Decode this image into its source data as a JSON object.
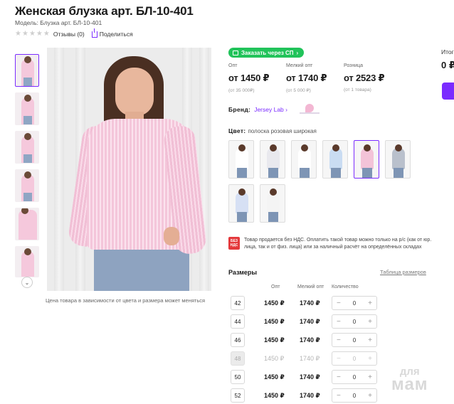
{
  "product": {
    "title": "Женская блузка арт. БЛ-10-401",
    "model": "Модель: Блузка арт. БЛ-10-401",
    "reviews": "Отзывы (0)",
    "share": "Поделиться",
    "rating": 0,
    "price_note": "Цена товара в зависимости от цвета и размера может меняться"
  },
  "sp_badge": "Заказать через СП",
  "prices": [
    {
      "label": "Опт",
      "value": "от 1450 ₽",
      "sub": "(от 35 000₽)"
    },
    {
      "label": "Мелкий опт",
      "value": "от 1740 ₽",
      "sub": "(от 5 000 ₽)"
    },
    {
      "label": "Розница",
      "value": "от 2523 ₽",
      "sub": "(от 1 товара)"
    }
  ],
  "brand": {
    "label": "Бренд:",
    "name": "Jersey Lab",
    "chevron": "›"
  },
  "color": {
    "label": "Цвет:",
    "value": "полоска розовая широкая"
  },
  "swatch_colors": [
    "#ffffff",
    "#e9e9ee",
    "#ffffff",
    "#c9dcf2",
    "#f3c3d8",
    "#b9c0cc",
    "#d6e0f4",
    "#f4f4f4"
  ],
  "nds": {
    "badge_line1": "БЕЗ",
    "badge_line2": "НДС",
    "text": "Товар продается без НДС. Оплатить такой товар можно только на р/с (как от юр. лица, так и от физ. лица) или за наличный расчёт на определённых складах"
  },
  "sizes": {
    "title": "Размеры",
    "table_link": "Таблица размеров",
    "headers": {
      "opt": "Опт",
      "small_opt": "Мелкий опт",
      "qty": "Количество"
    },
    "minus": "−",
    "plus": "+",
    "rows": [
      {
        "size": "42",
        "opt": "1450 ₽",
        "small_opt": "1740 ₽",
        "qty": "0"
      },
      {
        "size": "44",
        "opt": "1450 ₽",
        "small_opt": "1740 ₽",
        "qty": "0"
      },
      {
        "size": "46",
        "opt": "1450 ₽",
        "small_opt": "1740 ₽",
        "qty": "0"
      },
      {
        "size": "48",
        "opt": "1450 ₽",
        "small_opt": "1740 ₽",
        "qty": "0",
        "disabled": true
      },
      {
        "size": "50",
        "opt": "1450 ₽",
        "small_opt": "1740 ₽",
        "qty": "0"
      },
      {
        "size": "52",
        "opt": "1450 ₽",
        "small_opt": "1740 ₽",
        "qty": "0"
      }
    ]
  },
  "total": {
    "label": "Итого",
    "value": "0 ₽"
  },
  "watermark": {
    "line1": "для",
    "line2": "мам"
  },
  "icons": {
    "share": "share-icon",
    "sp": "cart-icon",
    "thumbs_down": "chevron-down-icon"
  },
  "accent": "#7b2cff",
  "sp_color": "#21c35a"
}
